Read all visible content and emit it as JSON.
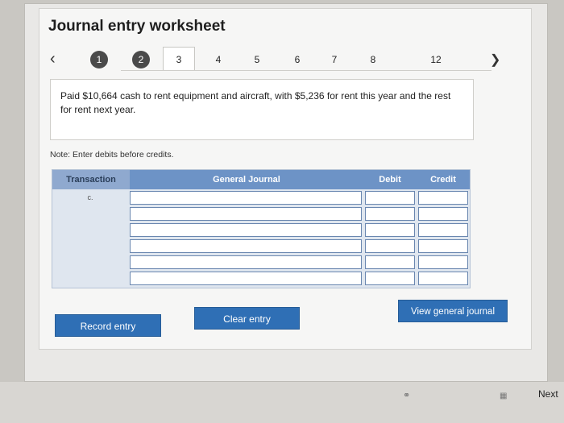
{
  "title": "Journal entry worksheet",
  "nav": {
    "prev_icon": "chevron-left-icon",
    "next_icon": "chevron-right-icon",
    "steps": [
      "1",
      "2",
      "3",
      "4",
      "5",
      "6",
      "7",
      "8",
      "12"
    ],
    "active_step": "3"
  },
  "prompt_text": "Paid $10,664 cash to rent equipment and aircraft, with $5,236 for rent this year and the rest for rent next year.",
  "note": "Note: Enter debits before credits.",
  "table": {
    "headers": {
      "transaction": "Transaction",
      "general_journal": "General Journal",
      "debit": "Debit",
      "credit": "Credit"
    },
    "rows": [
      {
        "transaction": "c.",
        "account": "",
        "debit": "",
        "credit": ""
      },
      {
        "transaction": "",
        "account": "",
        "debit": "",
        "credit": ""
      },
      {
        "transaction": "",
        "account": "",
        "debit": "",
        "credit": ""
      },
      {
        "transaction": "",
        "account": "",
        "debit": "",
        "credit": ""
      },
      {
        "transaction": "",
        "account": "",
        "debit": "",
        "credit": ""
      },
      {
        "transaction": "",
        "account": "",
        "debit": "",
        "credit": ""
      }
    ]
  },
  "buttons": {
    "record": "Record entry",
    "clear": "Clear entry",
    "view": "View general journal"
  },
  "footer": {
    "next": "Next"
  },
  "colors": {
    "button": "#2f6fb5",
    "table_header": "#6d93c6"
  }
}
